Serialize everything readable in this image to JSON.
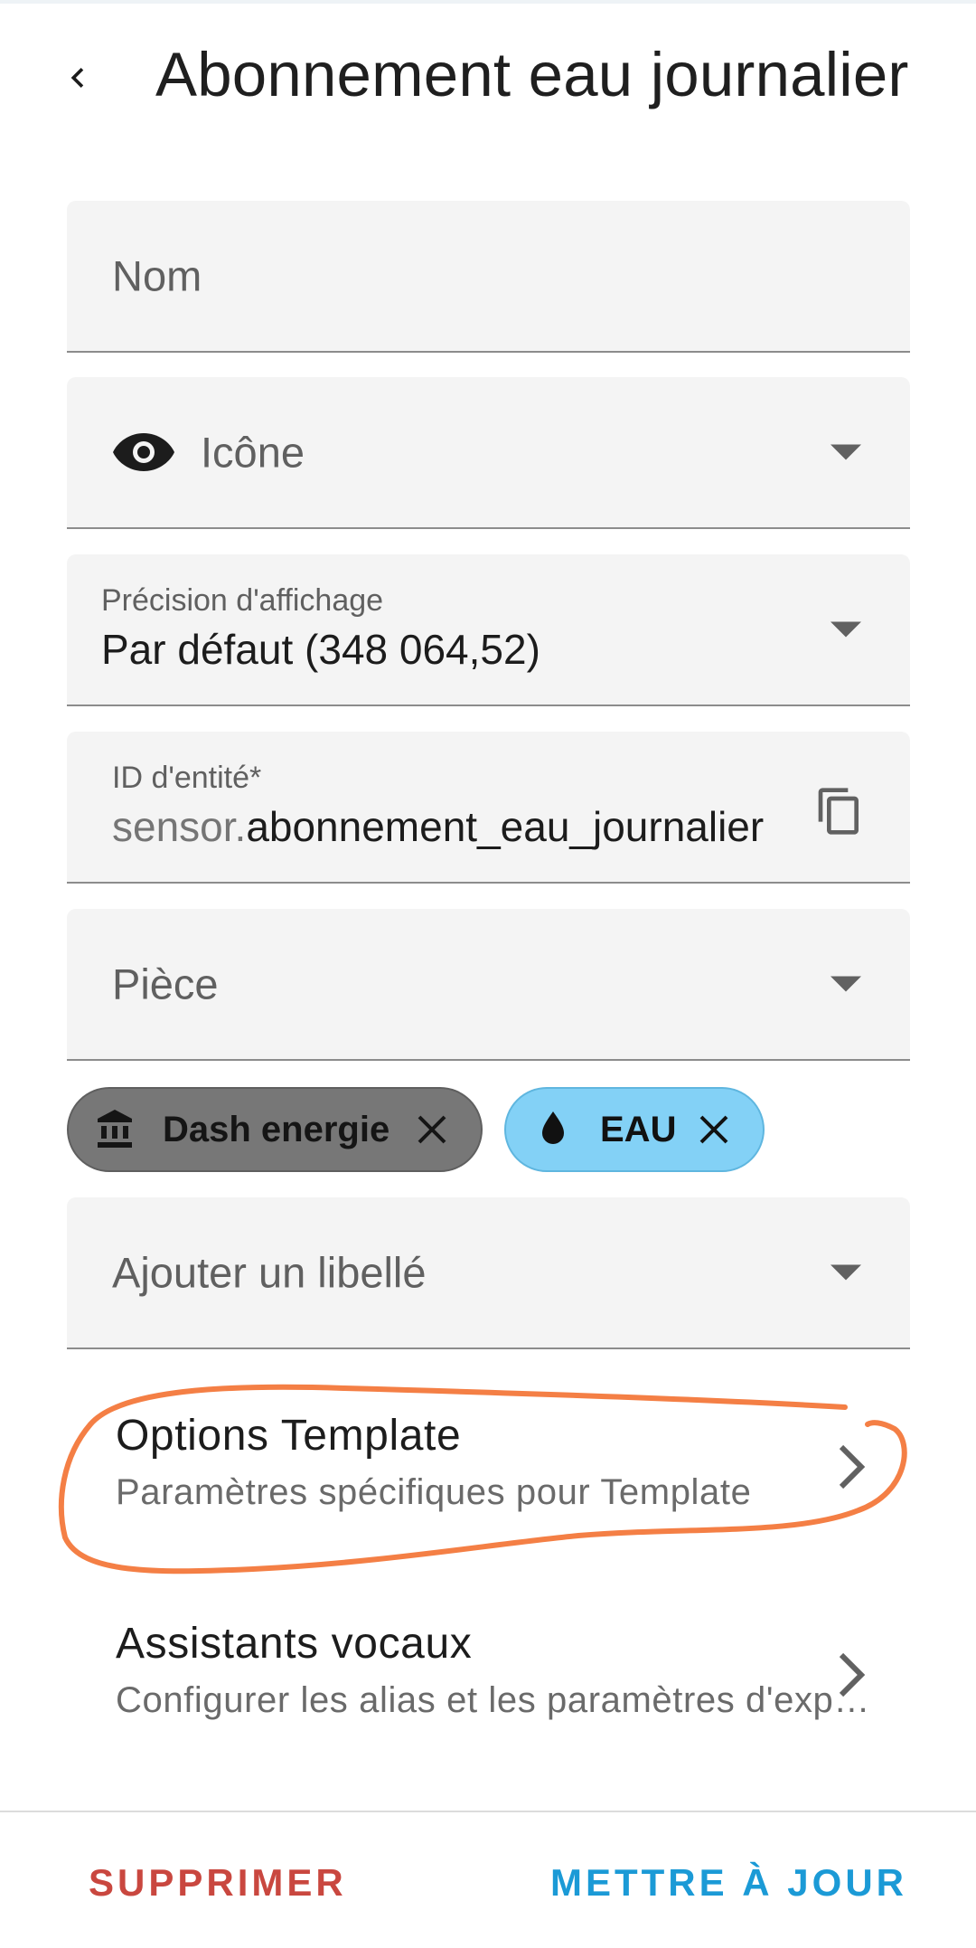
{
  "header": {
    "title": "Abonnement eau journalier"
  },
  "form": {
    "name_placeholder": "Nom",
    "icon_placeholder": "Icône",
    "precision": {
      "label": "Précision d'affichage",
      "value": "Par défaut (348 064,52)"
    },
    "entity_id": {
      "label": "ID d'entité*",
      "prefix": "sensor.",
      "value": "abonnement_eau_journalier"
    },
    "area_placeholder": "Pièce",
    "label_placeholder": "Ajouter un libellé"
  },
  "chips": [
    {
      "label": "Dash energie",
      "icon": "bank-icon",
      "color": "#777777"
    },
    {
      "label": "EAU",
      "icon": "water-drop-icon",
      "color": "#83d1f6"
    }
  ],
  "options": [
    {
      "title": "Options Template",
      "subtitle": "Paramètres spécifiques pour Template"
    },
    {
      "title": "Assistants vocaux",
      "subtitle": "Configurer les alias et les paramètres d'exposition"
    }
  ],
  "footer": {
    "delete_label": "SUPPRIMER",
    "update_label": "METTRE À JOUR"
  },
  "colors": {
    "delete": "#c9473f",
    "update": "#1b9ad6",
    "annotation": "#f47f45"
  }
}
